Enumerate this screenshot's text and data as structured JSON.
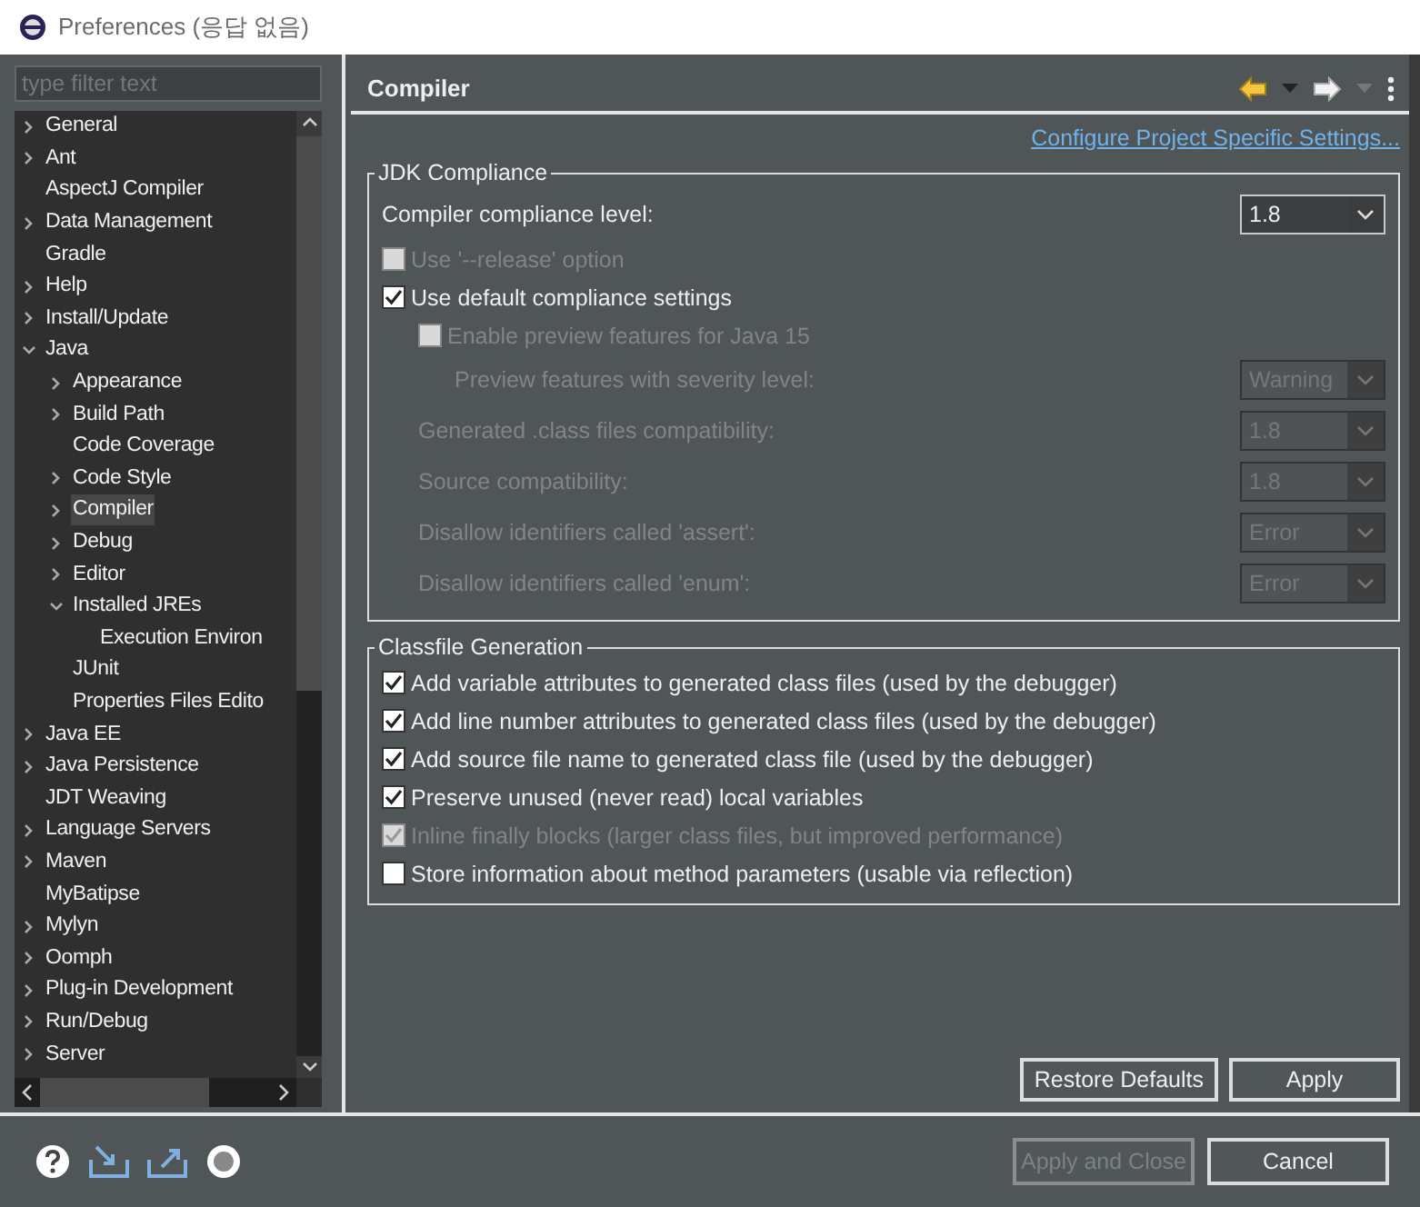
{
  "window": {
    "title": "Preferences (응답 없음)"
  },
  "filter": {
    "placeholder": "type filter text"
  },
  "tree": [
    {
      "label": "General",
      "expanded": false,
      "selected": false
    },
    {
      "label": "Ant",
      "expanded": false,
      "selected": false
    },
    {
      "label": "AspectJ Compiler",
      "selected": false
    },
    {
      "label": "Data Management",
      "expanded": false,
      "selected": false
    },
    {
      "label": "Gradle",
      "selected": false
    },
    {
      "label": "Help",
      "expanded": false,
      "selected": false
    },
    {
      "label": "Install/Update",
      "expanded": false,
      "selected": false
    },
    {
      "label": "Java",
      "expanded": true,
      "selected": false,
      "children": [
        {
          "label": "Appearance",
          "expanded": false,
          "selected": false
        },
        {
          "label": "Build Path",
          "expanded": false,
          "selected": false
        },
        {
          "label": "Code Coverage",
          "selected": false
        },
        {
          "label": "Code Style",
          "expanded": false,
          "selected": false
        },
        {
          "label": "Compiler",
          "expanded": false,
          "selected": true
        },
        {
          "label": "Debug",
          "expanded": false,
          "selected": false
        },
        {
          "label": "Editor",
          "expanded": false,
          "selected": false
        },
        {
          "label": "Installed JREs",
          "expanded": true,
          "selected": false,
          "children": [
            {
              "label": "Execution Environ",
              "selected": false
            }
          ]
        },
        {
          "label": "JUnit",
          "selected": false
        },
        {
          "label": "Properties Files Edito",
          "selected": false
        }
      ]
    },
    {
      "label": "Java EE",
      "expanded": false,
      "selected": false
    },
    {
      "label": "Java Persistence",
      "expanded": false,
      "selected": false
    },
    {
      "label": "JDT Weaving",
      "selected": false
    },
    {
      "label": "Language Servers",
      "expanded": false,
      "selected": false
    },
    {
      "label": "Maven",
      "expanded": false,
      "selected": false
    },
    {
      "label": "MyBatipse",
      "selected": false
    },
    {
      "label": "Mylyn",
      "expanded": false,
      "selected": false
    },
    {
      "label": "Oomph",
      "expanded": false,
      "selected": false
    },
    {
      "label": "Plug-in Development",
      "expanded": false,
      "selected": false
    },
    {
      "label": "Run/Debug",
      "expanded": false,
      "selected": false
    },
    {
      "label": "Server",
      "expanded": false,
      "selected": false
    }
  ],
  "page": {
    "title": "Compiler",
    "link": "Configure Project Specific Settings...",
    "groups": [
      {
        "title": "JDK Compliance",
        "items": [
          {
            "kind": "combo",
            "label": "Compiler compliance level:",
            "value": "1.8",
            "disabled": false
          },
          {
            "kind": "checkbox",
            "label": "Use '--release' option",
            "checked": false,
            "disabled": true
          },
          {
            "kind": "checkbox",
            "label": "Use default compliance settings",
            "checked": true,
            "disabled": false,
            "children": [
              {
                "kind": "checkbox",
                "label": "Enable preview features for Java 15",
                "checked": false,
                "disabled": true,
                "children": [
                  {
                    "kind": "combo",
                    "label": "Preview features with severity level:",
                    "value": "Warning",
                    "disabled": true
                  }
                ]
              },
              {
                "kind": "combo",
                "label": "Generated .class files compatibility:",
                "value": "1.8",
                "disabled": true
              },
              {
                "kind": "combo",
                "label": "Source compatibility:",
                "value": "1.8",
                "disabled": true
              },
              {
                "kind": "combo",
                "label": "Disallow identifiers called 'assert':",
                "value": "Error",
                "disabled": true
              },
              {
                "kind": "combo",
                "label": "Disallow identifiers called 'enum':",
                "value": "Error",
                "disabled": true
              }
            ]
          }
        ]
      },
      {
        "title": "Classfile Generation",
        "items": [
          {
            "kind": "checkbox",
            "label": "Add variable attributes to generated class files (used by the debugger)",
            "checked": true,
            "disabled": false
          },
          {
            "kind": "checkbox",
            "label": "Add line number attributes to generated class files (used by the debugger)",
            "checked": true,
            "disabled": false
          },
          {
            "kind": "checkbox",
            "label": "Add source file name to generated class file (used by the debugger)",
            "checked": true,
            "disabled": false
          },
          {
            "kind": "checkbox",
            "label": "Preserve unused (never read) local variables",
            "checked": true,
            "disabled": false
          },
          {
            "kind": "checkbox",
            "label": "Inline finally blocks (larger class files, but improved performance)",
            "checked": true,
            "disabled": true
          },
          {
            "kind": "checkbox",
            "label": "Store information about method parameters (usable via reflection)",
            "checked": false,
            "disabled": false
          }
        ]
      }
    ],
    "buttons": [
      {
        "label": "Restore Defaults",
        "disabled": false
      },
      {
        "label": "Apply",
        "disabled": false
      }
    ]
  },
  "footer_buttons": [
    {
      "label": "Apply and Close",
      "disabled": true
    },
    {
      "label": "Cancel",
      "disabled": false
    }
  ]
}
